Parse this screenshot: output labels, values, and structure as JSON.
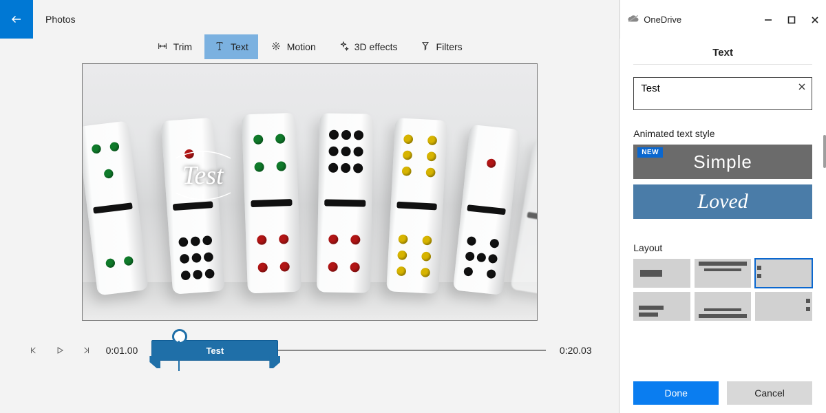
{
  "app": {
    "title": "Photos"
  },
  "cloud": {
    "label": "OneDrive"
  },
  "toolbar": {
    "trim": {
      "label": "Trim"
    },
    "text": {
      "label": "Text"
    },
    "motion": {
      "label": "Motion"
    },
    "fx": {
      "label": "3D effects"
    },
    "filters": {
      "label": "Filters"
    }
  },
  "overlay": {
    "text": "Test"
  },
  "playback": {
    "current": "0:01.00",
    "total": "0:20.03",
    "clip_label": "Test"
  },
  "panel": {
    "title": "Text",
    "input_value": "Test",
    "section_style": "Animated text style",
    "styles": {
      "simple": {
        "label": "Simple",
        "badge": "NEW"
      },
      "loved": {
        "label": "Loved"
      }
    },
    "section_layout": "Layout",
    "actions": {
      "done": "Done",
      "cancel": "Cancel"
    }
  }
}
